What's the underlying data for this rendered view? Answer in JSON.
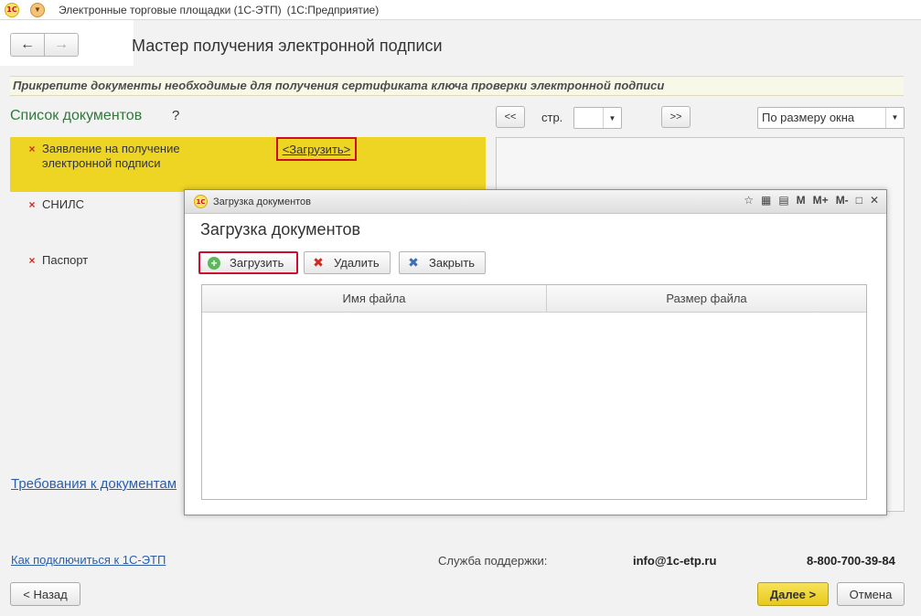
{
  "window": {
    "title": "Электронные торговые площадки (1С-ЭТП)",
    "app": "(1С:Предприятие)",
    "logo_text": "1С"
  },
  "navigation": {
    "back": "←",
    "forward": "→"
  },
  "page": {
    "title": "Мастер получения электронной подписи",
    "hint": "Прикрепите документы необходимые для получения сертификата ключа проверки электронной подписи"
  },
  "documents": {
    "title": "Список документов",
    "help": "?",
    "status_mark": "×",
    "items": [
      {
        "label_line1": "Заявление на получение",
        "label_line2": "электронной подписи",
        "selected": true
      },
      {
        "label_line1": "СНИЛС"
      },
      {
        "label_line1": "Паспорт"
      }
    ],
    "upload_link": "<Загрузить>",
    "requirements_link": "Требования к документам"
  },
  "preview": {
    "prev": "<<",
    "page_label": "стр.",
    "page_value": "",
    "next": ">>",
    "zoom": "По размеру окна"
  },
  "modal": {
    "window_title": "Загрузка документов",
    "heading": "Загрузка документов",
    "tools": [
      "M",
      "M+",
      "M-"
    ],
    "buttons": {
      "upload": "Загрузить",
      "delete": "Удалить",
      "close": "Закрыть"
    },
    "columns": [
      "Имя файла",
      "Размер файла"
    ],
    "rows": []
  },
  "footer": {
    "connect_link": "Как подключиться к 1С-ЭТП",
    "support_label": "Служба поддержки:",
    "email": "info@1c-etp.ru",
    "phone": "8-800-700-39-84",
    "back": "< Назад",
    "next": "Далее >",
    "cancel": "Отмена"
  },
  "colors": {
    "selected_row": "#eed523",
    "highlight_border": "#c8102e",
    "link": "#2a5ea8",
    "title_green": "#2f7a3a"
  }
}
